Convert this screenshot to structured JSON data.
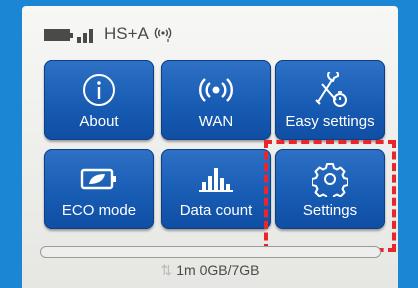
{
  "status": {
    "network_type": "HS+A",
    "battery_icon": "battery-icon",
    "signal_icon": "signal-bars-icon",
    "wifi_icon": "wifi-broadcast-icon"
  },
  "menu": {
    "about_label": "About",
    "wan_label": "WAN",
    "easy_settings_label": "Easy settings",
    "eco_mode_label": "ECO mode",
    "data_count_label": "Data count",
    "settings_label": "Settings"
  },
  "usage": {
    "duration": "1m",
    "amount": "0GB/7GB",
    "fraction": 0
  },
  "colors": {
    "tile": "#185cb4",
    "highlight": "#e8262b",
    "frame": "#1b86d3"
  }
}
